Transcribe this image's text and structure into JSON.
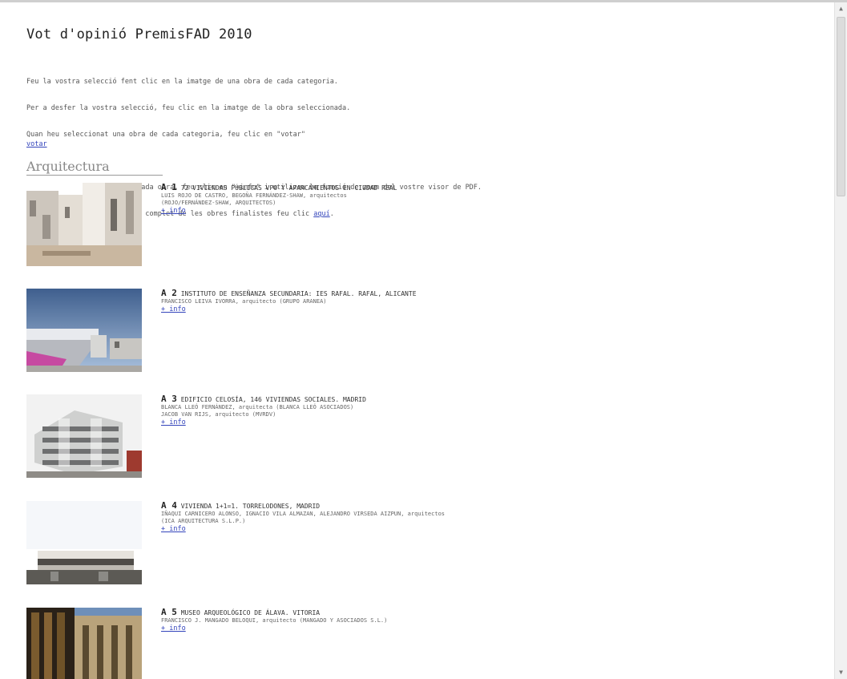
{
  "title": "Vot d'opinió PremisFAD 2010",
  "intro": [
    "Feu la vostra selecció fent clic en la imatge de una obra de cada categoria.",
    "Per a desfer la vostra selecció, feu clic en la imatge de la obra seleccionada.",
    "Quan heu seleccionat una obra de cada categoria, feu clic en \"votar\""
  ],
  "intro2_line1": "Per a veure els detalls de cada obra, feu clic en \"+info\" i utilizeu la funció de zoom del vostre visor de PDF.",
  "intro2_line2_prefix": "Per a descarregar un catàleg complet de les obres finalistes feu clic ",
  "intro2_link": "aquí",
  "intro2_line2_suffix": ".",
  "vote_label": "votar",
  "section": "Arquitectura",
  "info_label": "+ info",
  "entries": [
    {
      "code": "A 1",
      "title": "72 VIVIENDAS PÚBLICAS VPO Y APARCAMIENTOS EN CIUDAD REAL",
      "authors": [
        "LUIS ROJO DE CASTRO, BEGOÑA FERNÁNDEZ-SHAW, arquitectos",
        "(ROJO/FERNÁNDEZ-SHAW, ARQUITECTOS)"
      ]
    },
    {
      "code": "A 2",
      "title": "INSTITUTO DE ENSEÑANZA SECUNDARIA: IES RAFAL. RAFAL, ALICANTE",
      "authors": [
        "FRANCISCO LEIVA IVORRA, arquitecto (GRUPO ARANEA)"
      ]
    },
    {
      "code": "A 3",
      "title": "EDIFICIO CELOSÍA, 146 VIVIENDAS SOCIALES. MADRID",
      "authors": [
        "BLANCA LLEÓ FERNÁNDEZ, arquitecta (BLANCA LLEÓ ASOCIADOS)",
        "JACOB VAN RIJS, arquitecto (MVRDV)"
      ]
    },
    {
      "code": "A 4",
      "title": "VIVIENDA 1+1=1. TORRELODONES, MADRID",
      "authors": [
        "IÑAQUI CARNICERO ALONSO, IGNACIO VILA ALMAZAN, ALEJANDRO VIRSEDA AIZPUN, arquitectos",
        "(ICA ARQUITECTURA S.L.P.)"
      ]
    },
    {
      "code": "A 5",
      "title": "MUSEO ARQUEOLÓGICO DE ÁLAVA. VITORIA",
      "authors": [
        "FRANCISCO J. MANGADO BELOQUI, arquitecto (MANGADO Y ASOCIADOS S.L.)"
      ]
    }
  ]
}
